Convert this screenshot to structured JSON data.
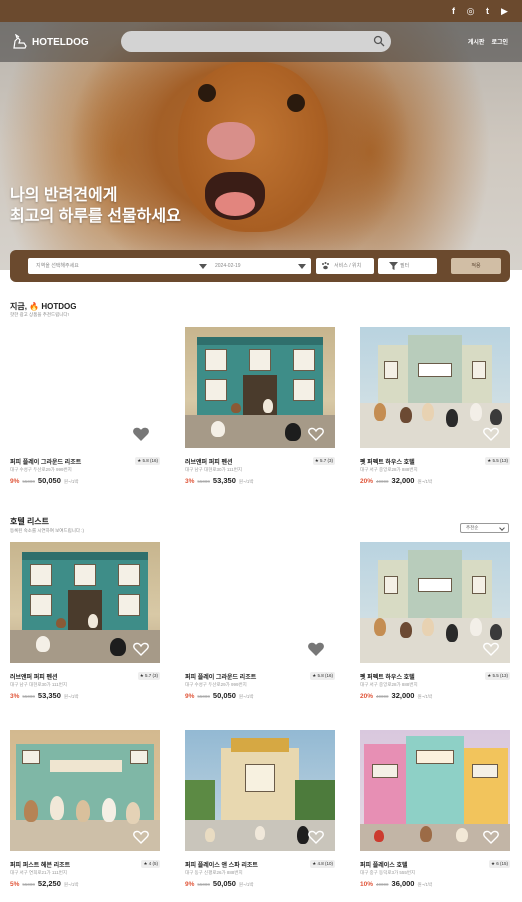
{
  "social": [
    "f",
    "◎",
    "t",
    "▶"
  ],
  "header": {
    "logo": "HOTELDOG",
    "nav": [
      "게시판",
      "로그인"
    ]
  },
  "hero": {
    "title_line1": "나의 반려견에게",
    "title_line2": "최고의 하루를 선물하세요"
  },
  "booking": {
    "region_placeholder": "지역을 선택해주세요",
    "date": "2024-02-19",
    "service": "서비스 / 위치",
    "filter": "필터",
    "search_button": "적용"
  },
  "hot": {
    "title": "지금,  🔥 HOTDOG",
    "subtitle": "핫한 광고 상품을 추천드립니다!"
  },
  "list": {
    "title": "호텔 리스트",
    "subtitle": "등록된 숙소를 시연하여 보여드립니다 :)",
    "sort": "추천순"
  },
  "colors": {
    "brand": "#6b4a2e",
    "discount": "#e0563a",
    "accent_button": "#d1bea5"
  },
  "hot_cards": [
    {
      "name": "퍼피 플레이 그라운드 리조트",
      "rating": "★ 5.8 (16)",
      "address": "대구 수성구 두산로29가 999번지",
      "discount": "9%",
      "original": "55000",
      "price": "50,050",
      "unit": "원~/1박",
      "image": "none"
    },
    {
      "name": "러브앤퍼 퍼피 펜션",
      "rating": "★ 5.7 (3)",
      "address": "대구 남구 대현로30가 111번지",
      "discount": "3%",
      "original": "55000",
      "price": "53,350",
      "unit": "원~/1박",
      "image": "teal"
    },
    {
      "name": "펫 퍼펙트 하우스 호텔",
      "rating": "★ 5.5 (13)",
      "address": "대구 서구 중앙로28가 888번지",
      "discount": "20%",
      "original": "40000",
      "price": "32,000",
      "unit": "원~/1박",
      "image": "villa"
    }
  ],
  "list_cards": [
    {
      "name": "러브앤퍼 퍼피 펜션",
      "rating": "★ 5.7 (3)",
      "address": "대구 남구 대현로30가 111번지",
      "discount": "3%",
      "original": "55000",
      "price": "53,350",
      "unit": "원~/1박",
      "image": "teal"
    },
    {
      "name": "퍼피 플레이 그라운드 리조트",
      "rating": "★ 5.8 (16)",
      "address": "대구 수성구 두산로29가 999번지",
      "discount": "9%",
      "original": "55000",
      "price": "50,050",
      "unit": "원~/1박",
      "image": "none"
    },
    {
      "name": "펫 퍼펙트 하우스 호텔",
      "rating": "★ 5.5 (13)",
      "address": "대구 서구 중앙로28가 888번지",
      "discount": "20%",
      "original": "40000",
      "price": "32,000",
      "unit": "원~/1박",
      "image": "villa"
    },
    {
      "name": "퍼피 퍼스트 헤븐 리조트",
      "rating": "★ 4 (5)",
      "address": "대구 서구 연희로21가 111번지",
      "discount": "5%",
      "original": "55000",
      "price": "52,250",
      "unit": "원~/1박",
      "image": "hotel"
    },
    {
      "name": "퍼피 플레이스 앤 스파 리조트",
      "rating": "★ 4.8 (10)",
      "address": "대구 동구 신평로26가 888번지",
      "discount": "9%",
      "original": "55000",
      "price": "50,050",
      "unit": "원~/1박",
      "image": "resort"
    },
    {
      "name": "퍼피 플레이스 호텔",
      "rating": "★ 6 (15)",
      "address": "대구 중구 동덕로3가 555번지",
      "discount": "10%",
      "original": "40000",
      "price": "36,000",
      "unit": "원~/1박",
      "image": "colorful"
    }
  ]
}
